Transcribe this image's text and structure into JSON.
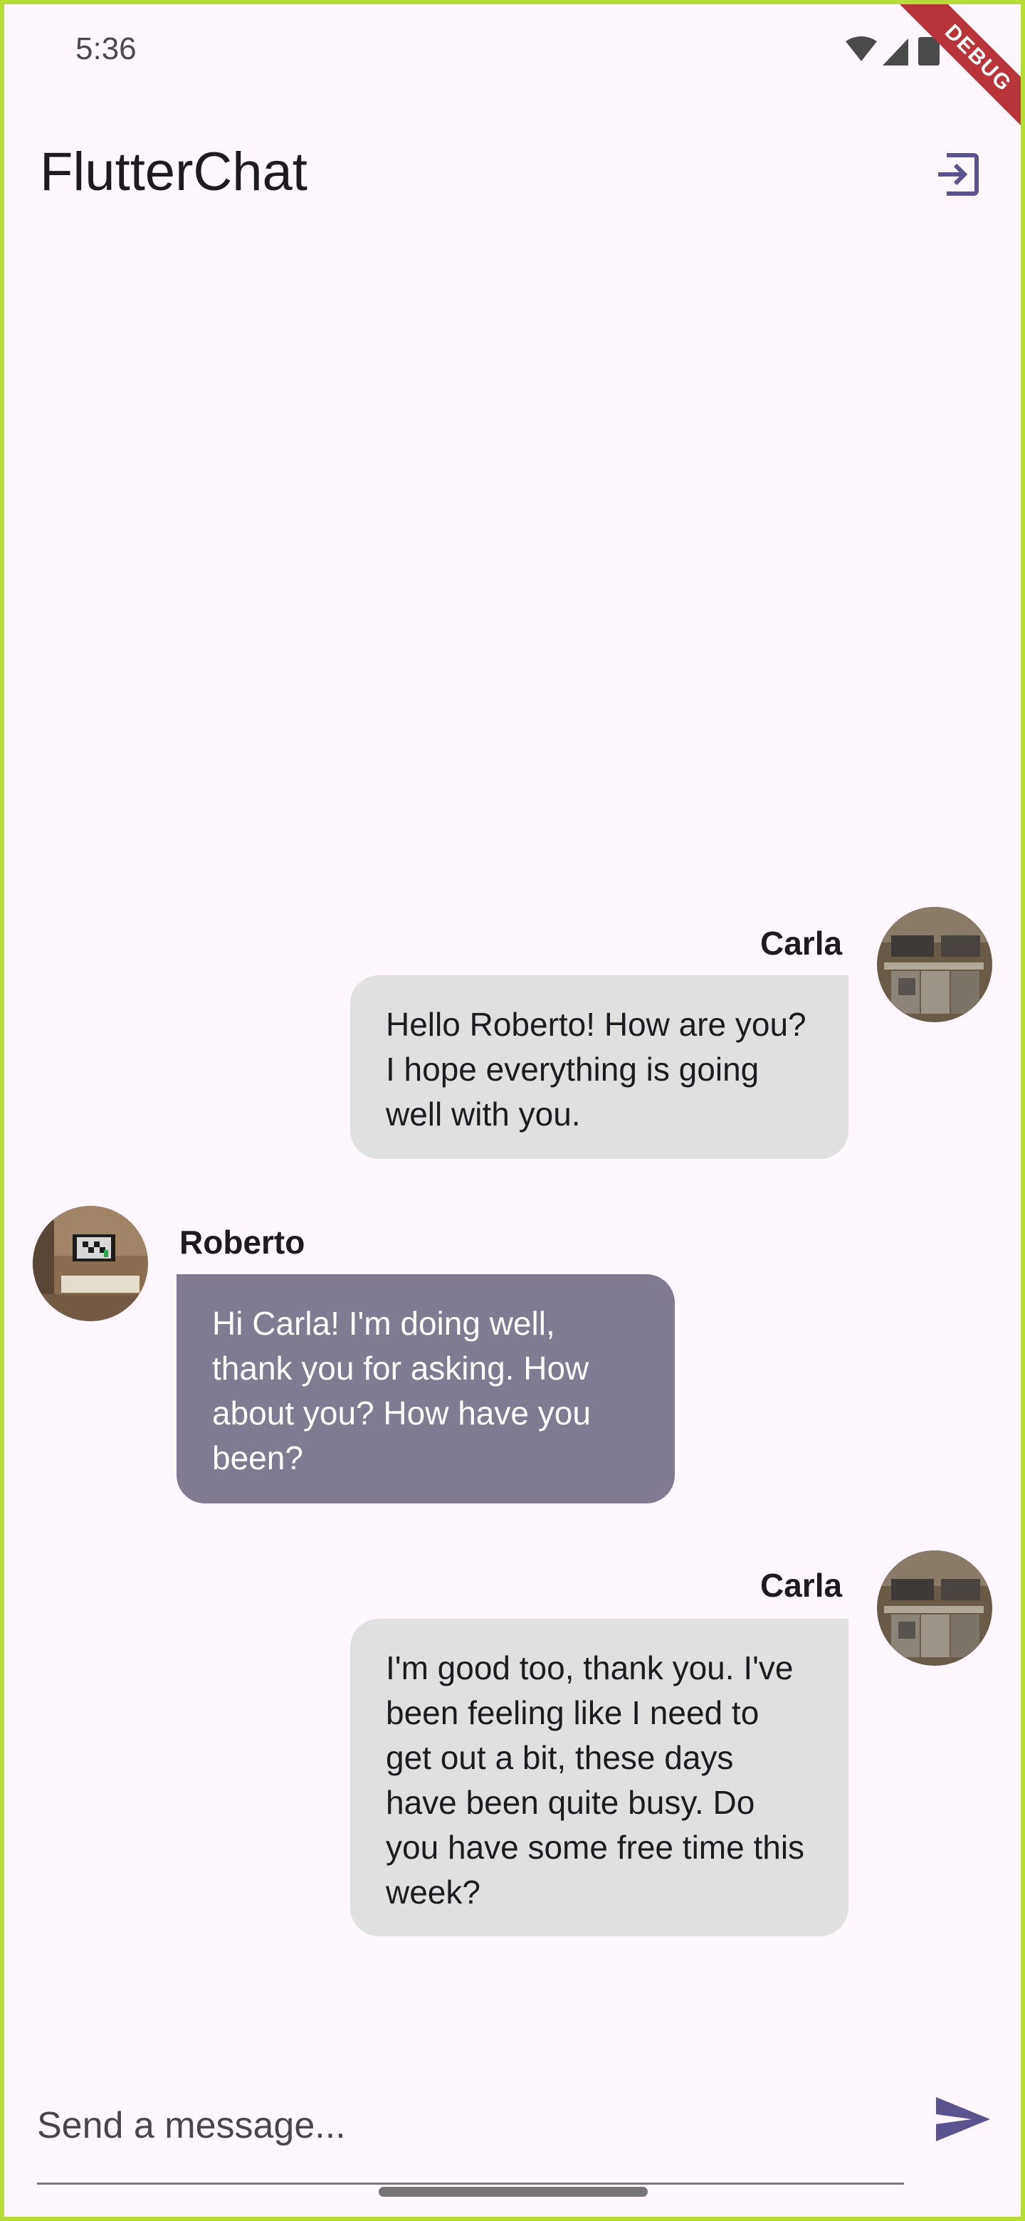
{
  "status_bar": {
    "time": "5:36",
    "icons": [
      "wifi-icon",
      "cellular-signal-icon",
      "battery-icon"
    ]
  },
  "debug_banner": {
    "label": "DEBUG"
  },
  "app_bar": {
    "title": "FlutterChat",
    "logout_icon": "logout-icon"
  },
  "messages": [
    {
      "sender": "Carla",
      "is_me": true,
      "text": "Hello Roberto! How are you? I hope everything is going well with you."
    },
    {
      "sender": "Roberto",
      "is_me": false,
      "text": "Hi Carla! I'm doing well, thank you for asking. How about you? How have you been?"
    },
    {
      "sender": "Carla",
      "is_me": true,
      "text": "I'm good too, thank you. I've been feeling like I need to get out a bit, these days have been quite busy. Do you have some free time this week?"
    }
  ],
  "composer": {
    "placeholder": "Send a message...",
    "value": "",
    "send_icon": "send-icon"
  },
  "colors": {
    "background": "#fef7fe",
    "my_bubble": "#e0e0e0",
    "other_bubble": "#807b90",
    "accent": "#6750a4",
    "debug_ribbon": "#b8343a"
  }
}
